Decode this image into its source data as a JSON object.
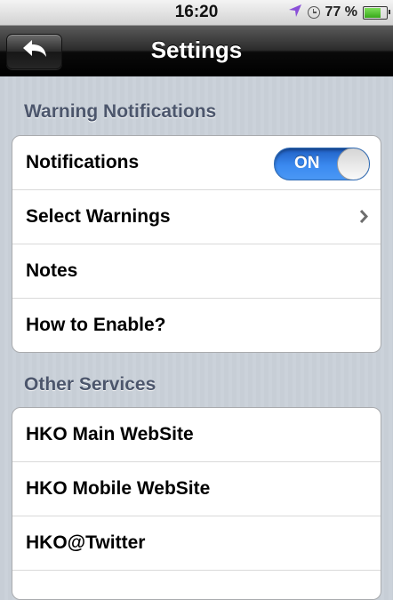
{
  "status_bar": {
    "time": "16:20",
    "battery_percent": "77 %",
    "battery_level": 0.77,
    "icons": [
      "location-arrow-icon",
      "clock-icon",
      "battery-icon"
    ]
  },
  "nav_bar": {
    "title": "Settings",
    "back_icon": "back-arrow-icon"
  },
  "sections": [
    {
      "header": "Warning Notifications",
      "rows": [
        {
          "label": "Notifications",
          "accessory": "toggle",
          "toggle_text": "ON",
          "toggle_on": true
        },
        {
          "label": "Select Warnings",
          "accessory": "chevron-right-icon"
        },
        {
          "label": "Notes"
        },
        {
          "label": "How to Enable?"
        }
      ]
    },
    {
      "header": "Other Services",
      "rows": [
        {
          "label": "HKO Main WebSite"
        },
        {
          "label": "HKO Mobile WebSite"
        },
        {
          "label": "HKO@Twitter"
        }
      ]
    }
  ],
  "colors": {
    "toggle_on": "#3b8af0",
    "section_header": "#4c566c",
    "background": "#c5ccd4",
    "location_arrow": "#8a4fd8",
    "battery_fill": "#38a81a"
  }
}
